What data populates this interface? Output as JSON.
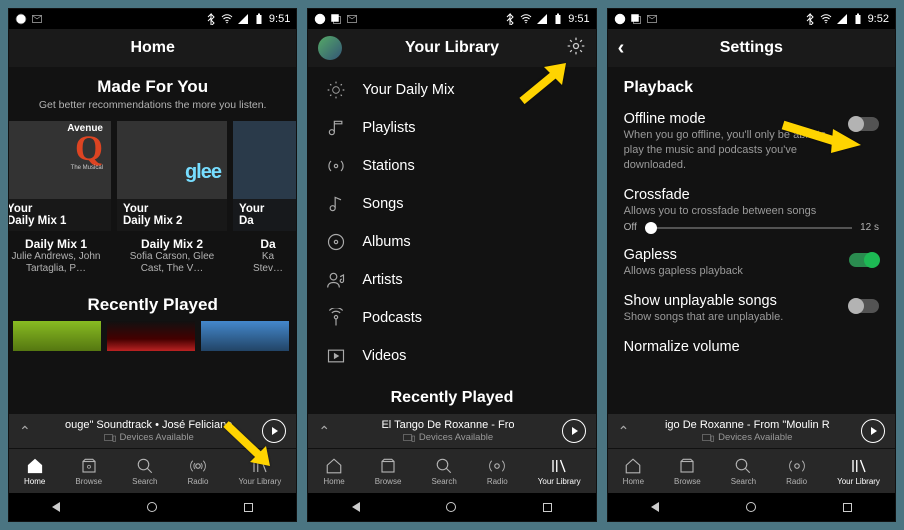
{
  "status": {
    "time": "9:51",
    "time2": "9:52"
  },
  "screen1": {
    "title": "Home",
    "made_head": "Made For You",
    "made_sub": "Get better recommendations the more you listen.",
    "cards": [
      {
        "ribbon": "Your\nDaily Mix 1",
        "name": "Daily Mix 1",
        "sub": "Julie Andrews, John Tartaglia, P…",
        "aven": "Avenue",
        "mus": "The Musical"
      },
      {
        "ribbon": "Your\nDaily Mix 2",
        "name": "Daily Mix 2",
        "sub": "Sofia Carson, Glee Cast, The V…",
        "glee": "glee"
      },
      {
        "ribbon": "Your\nDa",
        "name": "Da",
        "sub": "Ka\nStev…"
      }
    ],
    "rp_head": "Recently Played",
    "np_title": "ouge\" Soundtrack • José Feliciano",
    "np_dev": "Devices Available"
  },
  "screen2": {
    "title": "Your Library",
    "items": [
      "Your Daily Mix",
      "Playlists",
      "Stations",
      "Songs",
      "Albums",
      "Artists",
      "Podcasts",
      "Videos"
    ],
    "rp_head": "Recently Played",
    "np_title": "El Tango De Roxanne - Fro",
    "np_dev": "Devices Available"
  },
  "screen3": {
    "title": "Settings",
    "head": "Playback",
    "offline": {
      "label": "Offline mode",
      "desc": "When you go offline, you'll only be able to play the music and podcasts you've downloaded."
    },
    "cross": {
      "label": "Crossfade",
      "desc": "Allows you to crossfade between songs",
      "off": "Off",
      "max": "12 s"
    },
    "gapless": {
      "label": "Gapless",
      "desc": "Allows gapless playback"
    },
    "unplay": {
      "label": "Show unplayable songs",
      "desc": "Show songs that are unplayable."
    },
    "norm": {
      "label": "Normalize volume"
    },
    "np_title": "igo De Roxanne - From \"Moulin R",
    "np_dev": "Devices Available"
  },
  "tabs": [
    "Home",
    "Browse",
    "Search",
    "Radio",
    "Your Library"
  ]
}
